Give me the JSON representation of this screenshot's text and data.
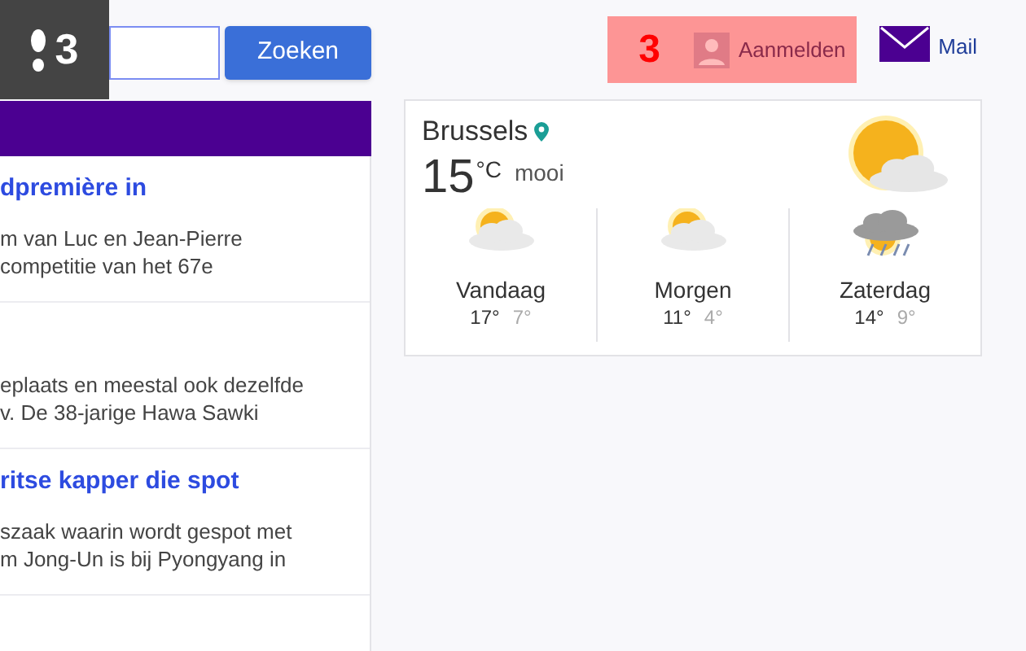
{
  "overlay_badge": {
    "text": "3"
  },
  "search": {
    "button": "Zoeken"
  },
  "annotation": {
    "number": "3"
  },
  "account": {
    "sign_in": "Aanmelden"
  },
  "mail": {
    "label": "Mail"
  },
  "news": [
    {
      "headline": "dpremière in",
      "lines": [
        "m van Luc en Jean-Pierre",
        "competitie van het 67e"
      ]
    },
    {
      "lines": [
        "eplaats en meestal ook dezelfde",
        "v. De 38-jarige Hawa Sawki"
      ]
    },
    {
      "headline": "ritse kapper die spot",
      "lines": [
        "szaak waarin wordt gespot met",
        "m Jong-Un is bij Pyongyang in"
      ]
    }
  ],
  "weather": {
    "city": "Brussels",
    "temperature": "15",
    "unit": "°C",
    "condition": "mooi",
    "kind": "sunny",
    "forecast": [
      {
        "day": "Vandaag",
        "high": "17°",
        "low": "7°",
        "kind": "partly-cloudy"
      },
      {
        "day": "Morgen",
        "high": "11°",
        "low": "4°",
        "kind": "partly-cloudy"
      },
      {
        "day": "Zaterdag",
        "high": "14°",
        "low": "9°",
        "kind": "storm"
      }
    ]
  }
}
